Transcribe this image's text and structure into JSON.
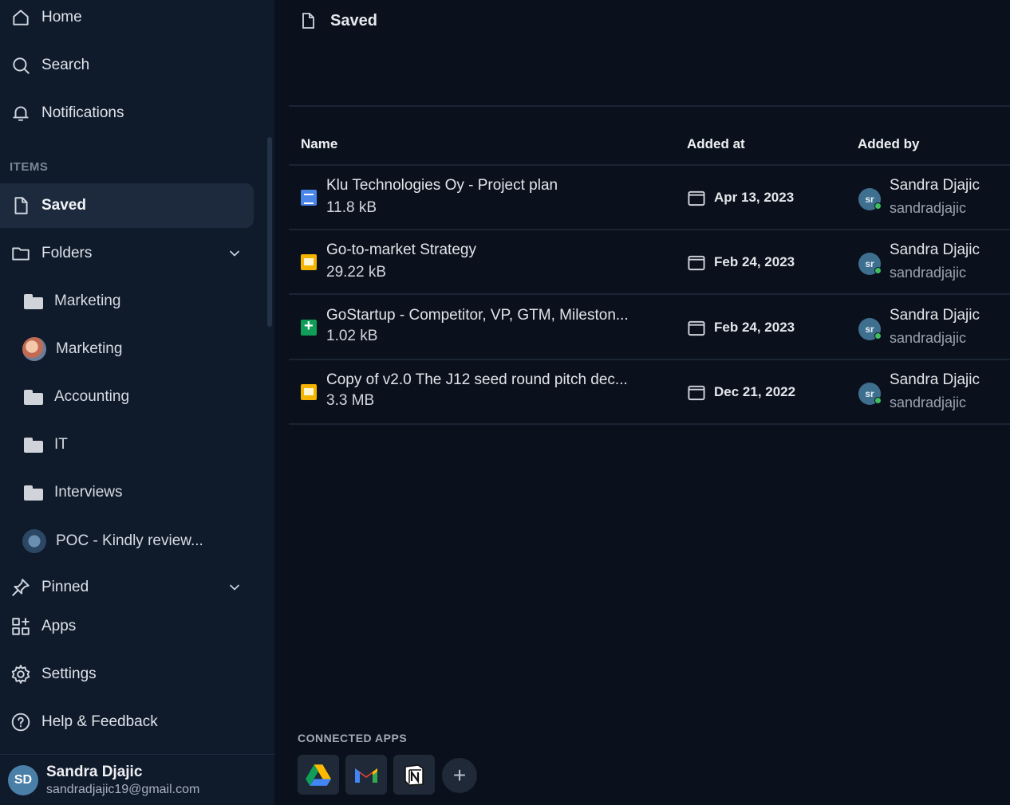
{
  "sidebar": {
    "nav": {
      "home": "Home",
      "search": "Search",
      "notifications": "Notifications"
    },
    "section_label": "ITEMS",
    "saved": "Saved",
    "folders": "Folders",
    "folder_items": [
      {
        "label": "Marketing",
        "icon": "folder-icon"
      },
      {
        "label": "Marketing",
        "icon": "avatar-thumbnail"
      },
      {
        "label": "Accounting",
        "icon": "folder-icon"
      },
      {
        "label": "IT",
        "icon": "folder-icon"
      },
      {
        "label": "Interviews",
        "icon": "folder-icon"
      },
      {
        "label": "POC - Kindly review...",
        "icon": "image-thumbnail"
      }
    ],
    "pinned": "Pinned",
    "apps": "Apps",
    "settings": "Settings",
    "help": "Help & Feedback",
    "user": {
      "initials": "SD",
      "name": "Sandra Djajic",
      "email": "sandradjajic19@gmail.com"
    }
  },
  "main": {
    "title": "Saved",
    "columns": {
      "name": "Name",
      "added_at": "Added at",
      "added_by": "Added by"
    },
    "rows": [
      {
        "name": "Klu Technologies Oy - Project plan",
        "size": "11.8 kB",
        "type": "doc",
        "date": "Apr 13, 2023",
        "by_name": "Sandra Djajic",
        "by_handle": "sandradjajic",
        "by_initials": "sr"
      },
      {
        "name": "Go-to-market Strategy",
        "size": "29.22 kB",
        "type": "slide",
        "date": "Feb 24, 2023",
        "by_name": "Sandra Djajic",
        "by_handle": "sandradjajic",
        "by_initials": "sr"
      },
      {
        "name": "GoStartup - Competitor, VP, GTM, Mileston...",
        "size": "1.02 kB",
        "type": "sheet",
        "date": "Feb 24, 2023",
        "by_name": "Sandra Djajic",
        "by_handle": "sandradjajic",
        "by_initials": "sr"
      },
      {
        "name": "Copy of v2.0 The J12 seed round pitch dec...",
        "size": "3.3 MB",
        "type": "slide",
        "date": "Dec 21, 2022",
        "by_name": "Sandra Djajic",
        "by_handle": "sandradjajic",
        "by_initials": "sr"
      }
    ],
    "connected_apps_label": "CONNECTED APPS",
    "connected_apps": [
      "google-drive-icon",
      "gmail-icon",
      "notion-icon"
    ],
    "add_symbol": "+"
  },
  "colors": {
    "sidebar_bg": "#0f1a2b",
    "main_bg": "#0b111c",
    "active_bg": "#1d2a3d",
    "online_dot": "#3fbf5f"
  }
}
